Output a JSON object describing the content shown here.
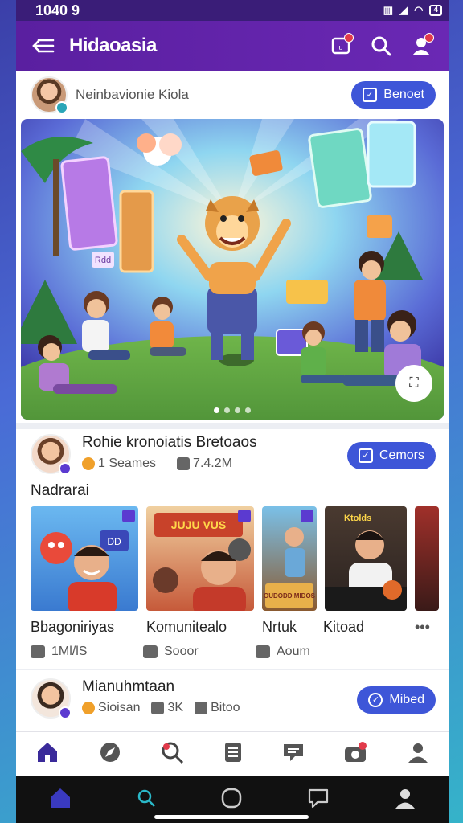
{
  "status_bar": {
    "time": "1040 9",
    "battery": "4"
  },
  "app_bar": {
    "title": "Hidaoasia",
    "icons": [
      "menu-icon",
      "inbox-icon",
      "search-icon",
      "profile-icon"
    ]
  },
  "post1": {
    "author": "Neinbavionie Kiola",
    "button_label": "Benoet"
  },
  "hero": {
    "label_tag": "Rdd",
    "slides": 4,
    "active_slide": 1
  },
  "post2": {
    "author": "Rohie kronoiatis Bretoaos",
    "stat1": "1 Seames",
    "stat2": "7.4.2M",
    "button_label": "Cemors"
  },
  "section": {
    "title": "Nadrarai",
    "thumbs": [
      {
        "label": "Bbagoniriyas",
        "overlay": "DD"
      },
      {
        "label": "Komunitealo",
        "overlay": "JUJU VUS"
      },
      {
        "label": "Nrtuk",
        "overlay": "OUDODD MIDOS"
      },
      {
        "label": "Kitoad",
        "overlay": "Ktolds"
      }
    ],
    "more_label": "•••"
  },
  "actions": {
    "like": "1Ml/lS",
    "comment": "Sooor",
    "share": "Aoum"
  },
  "post3": {
    "author": "Mianuhmtaan",
    "stat1": "Sioisan",
    "stat2": "3K",
    "stat3": "Bitoo",
    "button_label": "Mibed"
  },
  "colors": {
    "primary": "#3e56d8",
    "appbar": "#5a1fa0",
    "statusbar": "#3a1d78"
  }
}
